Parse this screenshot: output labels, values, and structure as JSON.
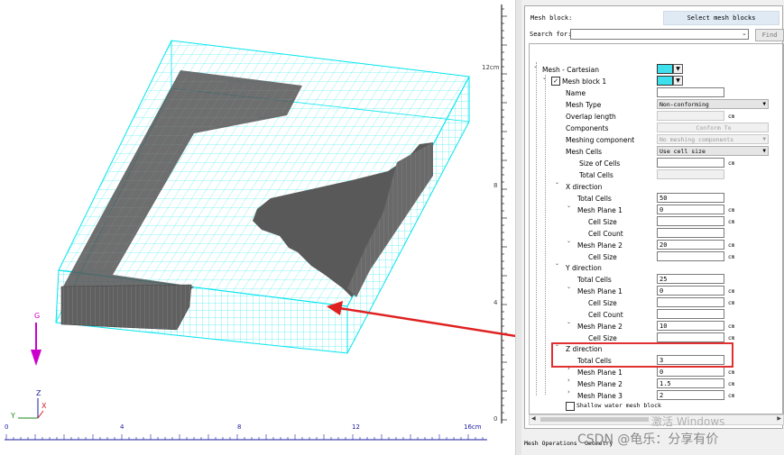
{
  "viewport": {
    "right_axis_labels": [
      "12cm",
      "8",
      "4",
      "0"
    ],
    "bottom_axis_labels": [
      "0",
      "4",
      "8",
      "12",
      "16cm"
    ],
    "gravity_label": "G",
    "triad": {
      "z": "Z",
      "y": "Y",
      "x": "X"
    }
  },
  "panel": {
    "mesh_block_label": "Mesh block:",
    "select_button": "Select  mesh blocks",
    "search_label": "Search for:",
    "search_value": "",
    "find_button": "Find",
    "tree": {
      "root": "Mesh - Cartesian",
      "block": "Mesh block 1",
      "fields": {
        "name": "Name",
        "mesh_type": "Mesh Type",
        "mesh_type_value": "Non-conforming",
        "overlap": "Overlap length",
        "components": "Components",
        "components_button": "Conform To",
        "meshing_component": "Meshing component",
        "meshing_component_value": "No meshing components",
        "mesh_cells": "Mesh Cells",
        "mesh_cells_value": "Use cell size",
        "size_of_cells": "Size of Cells",
        "total_cells": "Total Cells"
      },
      "x": {
        "title": "X direction",
        "total_cells_label": "Total Cells",
        "total_cells": "50",
        "plane1": "Mesh Plane 1",
        "plane1_value": "0",
        "cell_size": "Cell Size",
        "cell_count": "Cell Count",
        "plane2": "Mesh Plane 2",
        "plane2_value": "20",
        "cell_size2": "Cell Size"
      },
      "y": {
        "title": "Y direction",
        "total_cells_label": "Total Cells",
        "total_cells": "25",
        "plane1": "Mesh Plane 1",
        "plane1_value": "0",
        "cell_size": "Cell Size",
        "cell_count": "Cell Count",
        "plane2": "Mesh Plane 2",
        "plane2_value": "10",
        "cell_size2": "Cell Size"
      },
      "z": {
        "title": "Z direction",
        "total_cells_label": "Total Cells",
        "total_cells": "3",
        "plane1": "Mesh Plane 1",
        "plane1_value": "0",
        "plane2": "Mesh Plane 2",
        "plane2_value": "1.5",
        "plane3": "Mesh Plane 3",
        "plane3_value": "2"
      },
      "shallow_water": "Shallow water mesh block",
      "unit": "cm"
    },
    "tabs": [
      "Mesh Operations",
      "Geometry"
    ],
    "watermark1": "激活 Windows",
    "watermark2": "CSDN @龟乐：分享有价"
  },
  "colors": {
    "mesh": "#00e5ee",
    "solid": "#555555",
    "arrow": "#e02020",
    "gravity": "#cc00cc"
  }
}
